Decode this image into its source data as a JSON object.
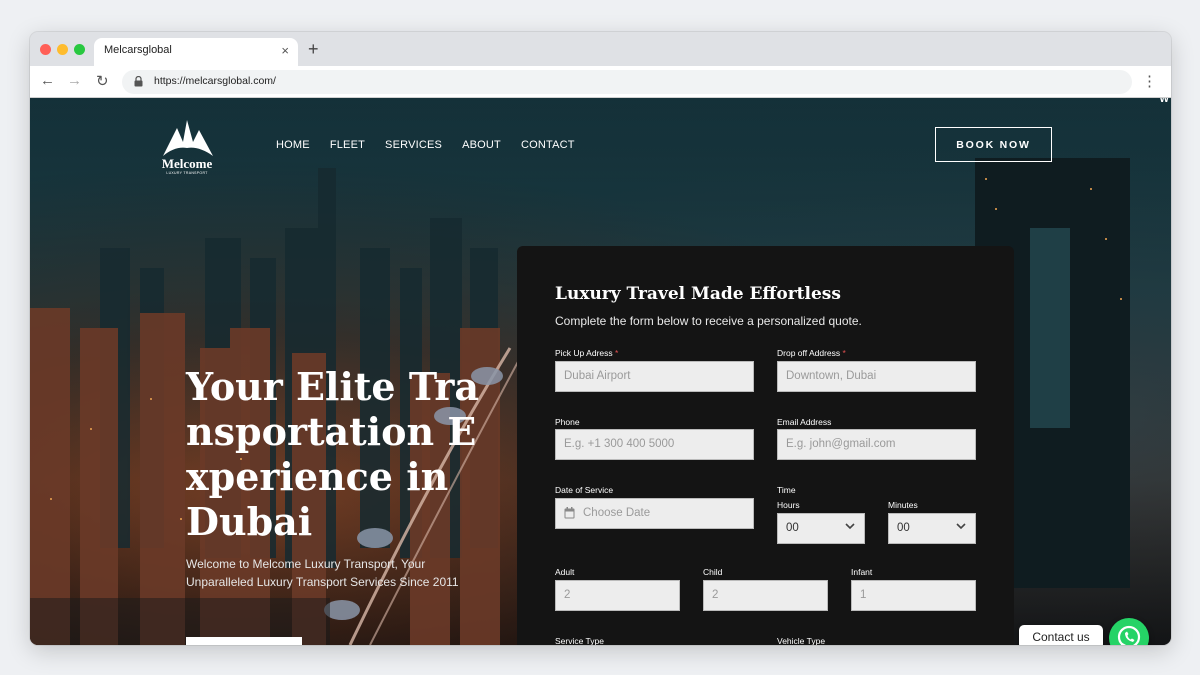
{
  "browser": {
    "tab_title": "Melcarsglobal",
    "tab_close": "×",
    "new_tab": "+",
    "url": "https://melcarsglobal.com/",
    "menu": "⋮"
  },
  "site": {
    "corner_text": "W",
    "logo": {
      "name": "Melcome",
      "tagline": "LUXURY TRANSPORT"
    },
    "nav": [
      "HOME",
      "FLEET",
      "SERVICES",
      "ABOUT",
      "CONTACT"
    ],
    "book_button": "BOOK NOW",
    "hero": {
      "title": "Your Elite Transportation Experience in Dubai",
      "subtitle": "Welcome to Melcome Luxury Transport, Your Unparalleled Luxury Transport Services Since 2011"
    }
  },
  "form": {
    "title": "Luxury Travel Made Effortless",
    "subtitle": "Complete the form below to receive a personalized quote.",
    "pickup": {
      "label": "Pick Up Adress",
      "required": "*",
      "placeholder": "Dubai Airport"
    },
    "dropoff": {
      "label": "Drop off Address",
      "required": "*",
      "placeholder": "Downtown, Dubai"
    },
    "phone": {
      "label": "Phone",
      "placeholder": "E.g. +1 300 400 5000"
    },
    "email": {
      "label": "Email Address",
      "placeholder": "E.g. john@gmail.com"
    },
    "date": {
      "label": "Date of Service",
      "placeholder": "Choose Date"
    },
    "time": {
      "label": "Time",
      "hours_label": "Hours",
      "hours_value": "00",
      "minutes_label": "Minutes",
      "minutes_value": "00"
    },
    "adult": {
      "label": "Adult",
      "placeholder": "2"
    },
    "child": {
      "label": "Child",
      "placeholder": "2"
    },
    "infant": {
      "label": "Infant",
      "placeholder": "1"
    },
    "service_type": {
      "label": "Service Type"
    },
    "vehicle_type": {
      "label": "Vehicle Type"
    }
  },
  "widgets": {
    "contact_label": "Contact us",
    "whatsapp_color": "#25d366"
  }
}
